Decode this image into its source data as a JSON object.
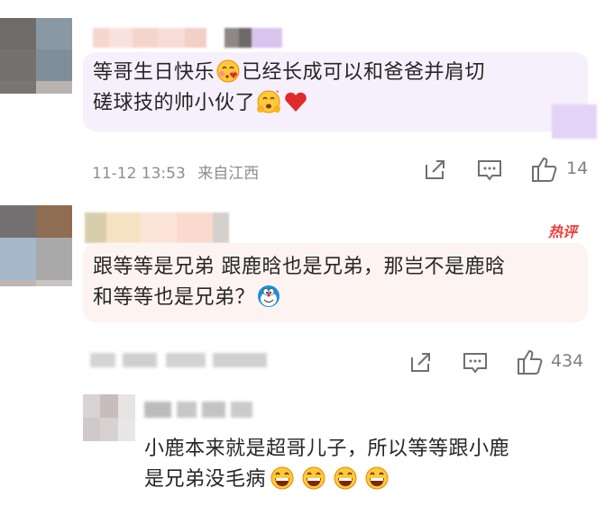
{
  "comments": [
    {
      "text_line1": "等哥生日快乐",
      "text_line1b": "已经长成可以和爸爸并肩切",
      "text_line2": "磋球技的帅小伙了",
      "timestamp": "11-12 13:53",
      "location": "来自江西",
      "like_count": "14"
    },
    {
      "hot_badge": "热评",
      "text_line1": "跟等等是兄弟 跟鹿晗也是兄弟，那岂不是鹿晗",
      "text_line2": "和等等也是兄弟？",
      "like_count": "434",
      "reply": {
        "text_line1": "小鹿本来就是超哥儿子，所以等等跟小鹿",
        "text_line2": "是兄弟没毛病"
      }
    }
  ],
  "icons": {
    "share": "share-icon",
    "comment": "comment-icon",
    "like": "thumbs-up-icon"
  },
  "colors": {
    "bubble1": "#f5f0fb",
    "bubble2": "#fdf3f1",
    "hot_badge": "#ef3b3b",
    "heart": "#e02b2b"
  }
}
